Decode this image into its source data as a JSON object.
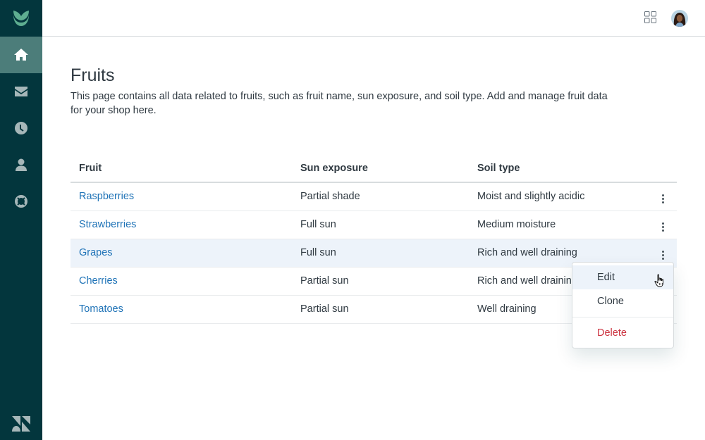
{
  "sidebar": {
    "logo_icon": "leaf-logo-icon",
    "items": [
      {
        "name": "home",
        "icon": "home-icon",
        "active": true
      },
      {
        "name": "mail",
        "icon": "mail-icon",
        "active": false
      },
      {
        "name": "history",
        "icon": "clock-icon",
        "active": false
      },
      {
        "name": "user",
        "icon": "person-icon",
        "active": false
      },
      {
        "name": "support",
        "icon": "lifebuoy-icon",
        "active": false
      }
    ],
    "brand_icon": "zendesk-logo-icon"
  },
  "header": {
    "apps_icon": "grid-icon",
    "avatar": "user-avatar"
  },
  "page": {
    "title": "Fruits",
    "description": "This page contains all data related to fruits, such as fruit name, sun exposure, and soil type. Add and manage fruit data for your shop here."
  },
  "table": {
    "headers": [
      "Fruit",
      "Sun exposure",
      "Soil type"
    ],
    "rows": [
      {
        "fruit": "Raspberries",
        "sun": "Partial shade",
        "soil": "Moist and slightly acidic"
      },
      {
        "fruit": "Strawberries",
        "sun": "Full sun",
        "soil": "Medium moisture"
      },
      {
        "fruit": "Grapes",
        "sun": "Full sun",
        "soil": "Rich and well draining"
      },
      {
        "fruit": "Cherries",
        "sun": "Partial sun",
        "soil": "Rich and well draining"
      },
      {
        "fruit": "Tomatoes",
        "sun": "Partial sun",
        "soil": "Well draining"
      }
    ],
    "hovered_row": 2
  },
  "menu": {
    "items": [
      {
        "label": "Edit",
        "focused": true
      },
      {
        "label": "Clone",
        "focused": false
      }
    ],
    "danger_item": {
      "label": "Delete"
    }
  },
  "colors": {
    "sidebar_bg": "#03363d",
    "sidebar_active": "#4c7d7a",
    "link": "#1f73b7",
    "danger": "#cc3340",
    "row_hover": "#edf3fa",
    "logo_green": "#5eae91"
  }
}
